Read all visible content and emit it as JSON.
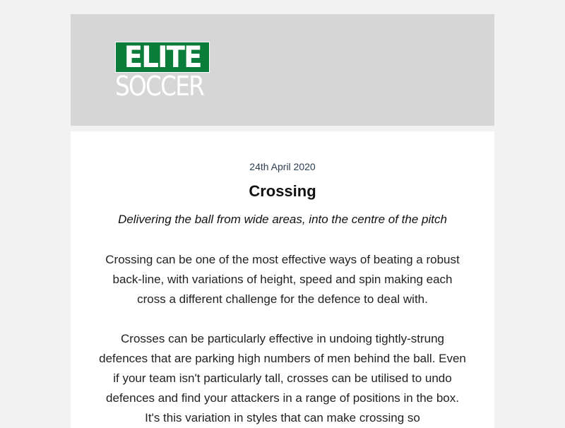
{
  "brand": {
    "logo_line1": "ELITE",
    "logo_line2": "SOCCER",
    "header_bg": "#d6d6d6",
    "logo_green": "#0b7d3a"
  },
  "article": {
    "date": "24th April 2020",
    "title": "Crossing",
    "subtitle": "Delivering the ball from wide areas, into the centre of the pitch",
    "paragraphs": [
      "Crossing can be one of the most effective ways of beating a robust back-line, with variations of height, speed and spin making each cross a different challenge for the defence to deal with.",
      "Crosses can be particularly effective in undoing tightly-strung defences that are parking high numbers of men behind the ball. Even if your team isn't particularly tall, crosses can be utilised to undo defences and find your attackers in a range of positions in the box.  It's this variation in styles that can make crossing so"
    ]
  }
}
